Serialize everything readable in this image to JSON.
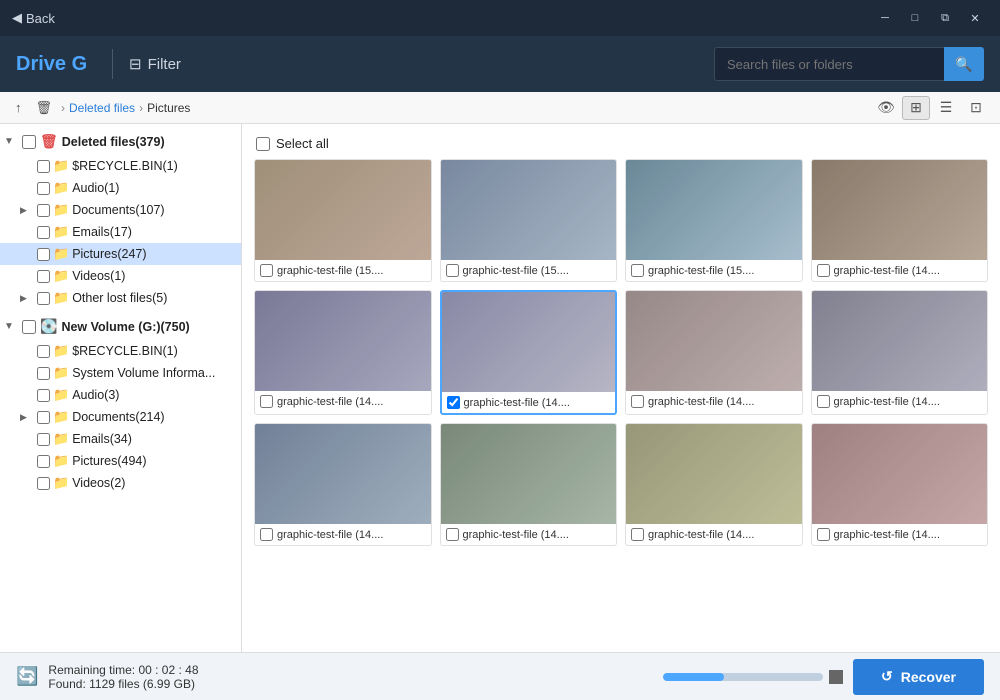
{
  "titlebar": {
    "back_label": "Back",
    "back_icon": "◀",
    "win_controls": [
      "─",
      "□",
      "✕"
    ]
  },
  "header": {
    "drive_title": "Drive G",
    "filter_label": "Filter",
    "filter_icon": "⊟",
    "search_placeholder": "Search files or folders",
    "search_icon": "🔍"
  },
  "breadcrumb": {
    "up_icon": "↑",
    "trash_icon": "🗑",
    "deleted_files": "Deleted files",
    "sep": "›",
    "current": "Pictures",
    "view_icons": [
      "👁",
      "⊞",
      "☰",
      "⊡"
    ]
  },
  "sidebar": {
    "deleted_section": {
      "label": "Deleted files(379)",
      "items": [
        {
          "label": "$RECYCLE.BIN(1)",
          "indent": 1
        },
        {
          "label": "Audio(1)",
          "indent": 1
        },
        {
          "label": "Documents(107)",
          "indent": 1,
          "expandable": true
        },
        {
          "label": "Emails(17)",
          "indent": 1
        },
        {
          "label": "Pictures(247)",
          "indent": 1,
          "selected": true
        },
        {
          "label": "Videos(1)",
          "indent": 1
        },
        {
          "label": "Other lost files(5)",
          "indent": 1,
          "expandable": true
        }
      ]
    },
    "volume_section": {
      "label": "New Volume (G:)(750)",
      "items": [
        {
          "label": "$RECYCLE.BIN(1)",
          "indent": 1
        },
        {
          "label": "System Volume Informa...",
          "indent": 1
        },
        {
          "label": "Audio(3)",
          "indent": 1
        },
        {
          "label": "Documents(214)",
          "indent": 1,
          "expandable": true
        },
        {
          "label": "Emails(34)",
          "indent": 1
        },
        {
          "label": "Pictures(494)",
          "indent": 1
        },
        {
          "label": "Videos(2)",
          "indent": 1
        }
      ]
    }
  },
  "files": {
    "select_all_label": "Select all",
    "items": [
      {
        "name": "graphic-test-file (15....",
        "imgClass": "img1",
        "selected": false
      },
      {
        "name": "graphic-test-file (15....",
        "imgClass": "img2",
        "selected": false
      },
      {
        "name": "graphic-test-file (15....",
        "imgClass": "img3",
        "selected": false
      },
      {
        "name": "graphic-test-file (14....",
        "imgClass": "img4",
        "selected": false
      },
      {
        "name": "graphic-test-file (14....",
        "imgClass": "img5",
        "selected": false
      },
      {
        "name": "graphic-test-file (14....",
        "imgClass": "img6",
        "selected": true
      },
      {
        "name": "graphic-test-file (14....",
        "imgClass": "img7",
        "selected": false
      },
      {
        "name": "graphic-test-file (14....",
        "imgClass": "img8",
        "selected": false
      },
      {
        "name": "graphic-test-file (14....",
        "imgClass": "img9",
        "selected": false
      },
      {
        "name": "graphic-test-file (14....",
        "imgClass": "img10",
        "selected": false
      },
      {
        "name": "graphic-test-file (14....",
        "imgClass": "img11",
        "selected": false
      },
      {
        "name": "graphic-test-file (14....",
        "imgClass": "img12",
        "selected": false
      }
    ]
  },
  "bottombar": {
    "remaining_label": "Remaining time: 00 : 02 : 48",
    "found_label": "Found: 1129 files (6.99 GB)",
    "progress_percent": 38,
    "recover_icon": "↺",
    "recover_label": "Recover"
  }
}
